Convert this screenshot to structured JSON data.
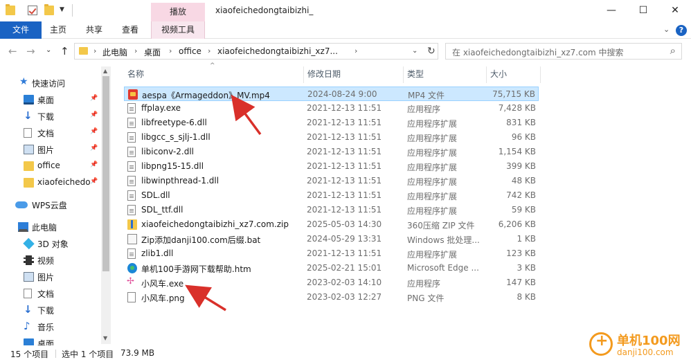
{
  "window": {
    "title": "xiaofeichedongtaibizhi_",
    "context_tab": "播放",
    "controls": {
      "minimize": "—",
      "maximize": "☐",
      "close": "✕"
    }
  },
  "ribbon": {
    "tabs": [
      "文件",
      "主页",
      "共享",
      "查看",
      "视频工具"
    ]
  },
  "address": {
    "crumbs": [
      "此电脑",
      "桌面",
      "office",
      "xiaofeichedongtaibizhi_xz7..."
    ],
    "separator": "›"
  },
  "search": {
    "placeholder": "在 xiaofeichedongtaibizhi_xz7.com 中搜索"
  },
  "nav": {
    "items": [
      {
        "label": "快速访问",
        "icon": "star-icon",
        "pinned": false
      },
      {
        "label": "桌面",
        "icon": "desktop-icon",
        "pinned": true
      },
      {
        "label": "下载",
        "icon": "download-icon",
        "pinned": true
      },
      {
        "label": "文档",
        "icon": "document-icon",
        "pinned": true
      },
      {
        "label": "图片",
        "icon": "picture-icon",
        "pinned": true
      },
      {
        "label": "office",
        "icon": "folder-icon",
        "pinned": true
      },
      {
        "label": "xiaofeichedo",
        "icon": "folder-icon",
        "pinned": true
      },
      {
        "label": "WPS云盘",
        "icon": "cloud-icon",
        "pinned": false
      },
      {
        "label": "此电脑",
        "icon": "computer-icon",
        "pinned": false
      },
      {
        "label": "3D 对象",
        "icon": "3d-objects-icon",
        "pinned": false
      },
      {
        "label": "视频",
        "icon": "video-icon",
        "pinned": false
      },
      {
        "label": "图片",
        "icon": "picture-icon",
        "pinned": false
      },
      {
        "label": "文档",
        "icon": "document-icon",
        "pinned": false
      },
      {
        "label": "下载",
        "icon": "download-icon",
        "pinned": false
      },
      {
        "label": "音乐",
        "icon": "music-icon",
        "pinned": false
      },
      {
        "label": "桌面",
        "icon": "desktop-icon",
        "pinned": false
      }
    ]
  },
  "columns": {
    "name": "名称",
    "date": "修改日期",
    "type": "类型",
    "size": "大小"
  },
  "files": [
    {
      "name": "aespa《Armageddon》MV.mp4",
      "date": "2024-08-24 9:00",
      "type": "MP4 文件",
      "size": "75,715 KB",
      "icon": "mp4-icon",
      "selected": true
    },
    {
      "name": "ffplay.exe",
      "date": "2021-12-13 11:51",
      "type": "应用程序",
      "size": "7,428 KB",
      "icon": "file-icon",
      "selected": false
    },
    {
      "name": "libfreetype-6.dll",
      "date": "2021-12-13 11:51",
      "type": "应用程序扩展",
      "size": "831 KB",
      "icon": "file-icon",
      "selected": false
    },
    {
      "name": "libgcc_s_sjlj-1.dll",
      "date": "2021-12-13 11:51",
      "type": "应用程序扩展",
      "size": "96 KB",
      "icon": "file-icon",
      "selected": false
    },
    {
      "name": "libiconv-2.dll",
      "date": "2021-12-13 11:51",
      "type": "应用程序扩展",
      "size": "1,154 KB",
      "icon": "file-icon",
      "selected": false
    },
    {
      "name": "libpng15-15.dll",
      "date": "2021-12-13 11:51",
      "type": "应用程序扩展",
      "size": "399 KB",
      "icon": "file-icon",
      "selected": false
    },
    {
      "name": "libwinpthread-1.dll",
      "date": "2021-12-13 11:51",
      "type": "应用程序扩展",
      "size": "48 KB",
      "icon": "file-icon",
      "selected": false
    },
    {
      "name": "SDL.dll",
      "date": "2021-12-13 11:51",
      "type": "应用程序扩展",
      "size": "742 KB",
      "icon": "file-icon",
      "selected": false
    },
    {
      "name": "SDL_ttf.dll",
      "date": "2021-12-13 11:51",
      "type": "应用程序扩展",
      "size": "59 KB",
      "icon": "file-icon",
      "selected": false
    },
    {
      "name": "xiaofeichedongtaibizhi_xz7.com.zip",
      "date": "2025-05-03 14:30",
      "type": "360压缩 ZIP 文件",
      "size": "6,206 KB",
      "icon": "zip-icon",
      "selected": false
    },
    {
      "name": "Zip添加danji100.com后缀.bat",
      "date": "2024-05-29 13:31",
      "type": "Windows 批处理...",
      "size": "1 KB",
      "icon": "bat-icon",
      "selected": false
    },
    {
      "name": "zlib1.dll",
      "date": "2021-12-13 11:51",
      "type": "应用程序扩展",
      "size": "123 KB",
      "icon": "file-icon",
      "selected": false
    },
    {
      "name": "单机100手游网下载帮助.htm",
      "date": "2025-02-21 15:01",
      "type": "Microsoft Edge ...",
      "size": "3 KB",
      "icon": "edge-icon",
      "selected": false
    },
    {
      "name": "小风车.exe",
      "date": "2023-02-03 14:10",
      "type": "应用程序",
      "size": "147 KB",
      "icon": "pinwheel-icon",
      "selected": false
    },
    {
      "name": "小风车.png",
      "date": "2023-02-03 12:27",
      "type": "PNG 文件",
      "size": "8 KB",
      "icon": "png-icon",
      "selected": false
    }
  ],
  "status": {
    "count": "15 个项目",
    "selected": "选中 1 个项目",
    "size": "73.9 MB"
  },
  "watermark": {
    "line1": "单机100网",
    "line2": "danji100.com"
  },
  "colors": {
    "accent": "#1a63c3",
    "selection": "#cce8ff",
    "arrow": "#d9302a"
  }
}
